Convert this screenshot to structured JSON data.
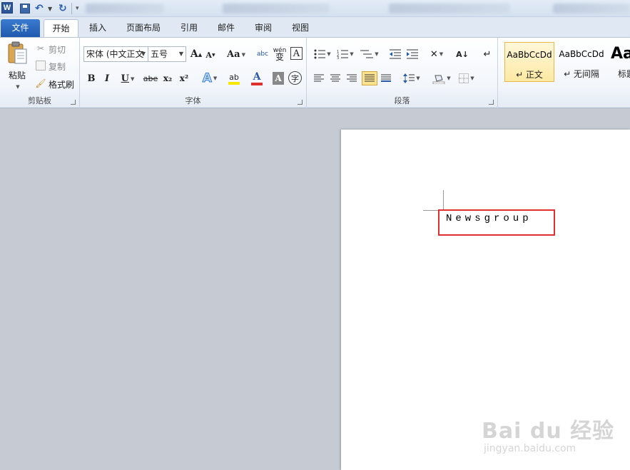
{
  "quick_access": {
    "app_icon_letter": "W",
    "blurred_tabs": 5
  },
  "tabs": [
    {
      "label": "文件"
    },
    {
      "label": "开始"
    },
    {
      "label": "插入"
    },
    {
      "label": "页面布局"
    },
    {
      "label": "引用"
    },
    {
      "label": "邮件"
    },
    {
      "label": "审阅"
    },
    {
      "label": "视图"
    }
  ],
  "clipboard": {
    "label": "剪贴板",
    "paste": "粘贴",
    "cut": "剪切",
    "copy": "复制",
    "format_painter": "格式刷"
  },
  "font": {
    "label": "字体",
    "font_name": "宋体 (中文正文",
    "font_size": "五号",
    "grow": "A",
    "shrink": "A",
    "change_case": "Aa",
    "clear_format": "abc",
    "phonetic": "wén",
    "border_char": "A",
    "bold": "B",
    "italic": "I",
    "underline": "U",
    "strike": "abe",
    "subscript": "x₂",
    "superscript": "x²",
    "text_effect": "A",
    "highlight": "ab",
    "font_color": "A",
    "char_shading": "A",
    "enclose": "字"
  },
  "paragraph": {
    "label": "段落"
  },
  "styles": [
    {
      "sample": "AaBbCcDd",
      "name": "↵ 正文"
    },
    {
      "sample": "AaBbCcDd",
      "name": "↵ 无间隔"
    },
    {
      "sample": "Aa",
      "name": "标题"
    }
  ],
  "document": {
    "text": "Newsgroup"
  },
  "watermark": {
    "main": "Bai du 经验",
    "sub": "jingyan.baidu.com"
  },
  "colors": {
    "accent": "#2b579a",
    "highlight_border": "#e0302e",
    "font_color_bar": "#e0302e",
    "highlight_bar": "#f6e600",
    "selected_style_bg": "#fde9a4"
  }
}
